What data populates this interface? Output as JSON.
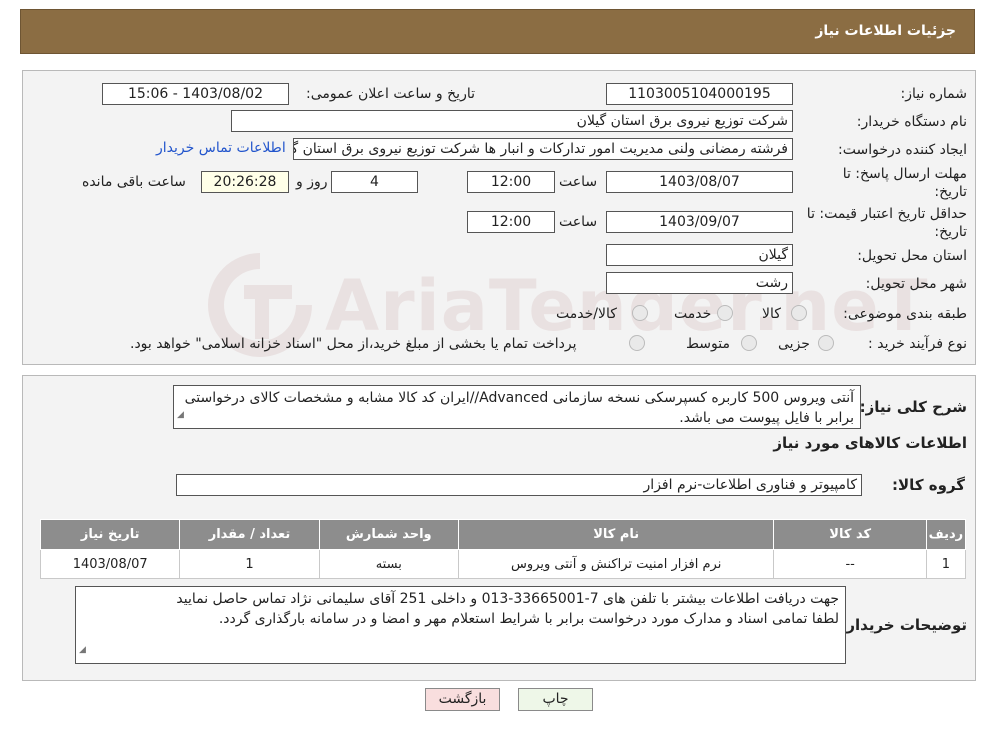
{
  "header": {
    "title": "جزئیات اطلاعات نیاز"
  },
  "info": {
    "need_number_label": "شماره نیاز:",
    "need_number": "1103005104000195",
    "announce_label": "تاریخ و ساعت اعلان عمومی:",
    "announce_value": "1403/08/02 - 15:06",
    "buyer_org_label": "نام دستگاه خریدار:",
    "buyer_org": "شرکت توزیع نیروی برق استان گیلان",
    "creator_label": "ایجاد کننده درخواست:",
    "creator": "فرشته رمضانی ولنی مدیریت امور تدارکات و انبار ها شرکت توزیع نیروی برق استان گیلان",
    "contact_link": "اطلاعات تماس خریدار",
    "reply_deadline_label_1": "مهلت ارسال پاسخ: تا",
    "reply_deadline_label_2": "تاریخ:",
    "reply_date": "1403/08/07",
    "time_label": "ساعت",
    "reply_time": "12:00",
    "days_value": "4",
    "days_label": "روز و",
    "remaining_time": "20:26:28",
    "remaining_label": "ساعت باقی مانده",
    "price_validity_label_1": "حداقل تاریخ اعتبار قیمت: تا",
    "price_validity_label_2": "تاریخ:",
    "price_date": "1403/09/07",
    "price_time": "12:00",
    "province_label": "استان محل تحویل:",
    "province": "گیلان",
    "city_label": "شهر محل تحویل:",
    "city": "رشت",
    "category_label": "طبقه بندی موضوعی:",
    "category_options": [
      "کالا",
      "خدمت",
      "کالا/خدمت"
    ],
    "process_label": "نوع فرآیند خرید :",
    "process_options": [
      "جزیی",
      "متوسط"
    ],
    "process_note": "پرداخت تمام یا بخشی از مبلغ خرید،از محل \"اسناد خزانه اسلامی\" خواهد بود."
  },
  "details": {
    "summary_label": "شرح کلی نیاز:",
    "summary": "آنتی ویروس 500 کاربره کسپرسکی نسخه سازمانی Advanced//ایران کد کالا مشابه و مشخصات کالای درخواستی برابر با فایل پیوست می باشد.",
    "goods_info_title": "اطلاعات کالاهای مورد نیاز",
    "goods_group_label": "گروه کالا:",
    "goods_group": "کامپیوتر و فناوری اطلاعات-نرم افزار",
    "table": {
      "headers": [
        "ردیف",
        "کد کالا",
        "نام کالا",
        "واحد شمارش",
        "تعداد / مقدار",
        "تاریخ نیاز"
      ],
      "rows": [
        [
          "1",
          "--",
          "نرم افزار امنیت تراکنش و آنتی ویروس",
          "بسته",
          "1",
          "1403/08/07"
        ]
      ]
    },
    "buyer_notes_label": "توضیحات خریدار:",
    "buyer_notes_line1": "جهت دریافت اطلاعات بیشتر با تلفن های 7-33665001-013 و داخلی 251 آقای سلیمانی نژاد تماس حاصل نمایید",
    "buyer_notes_line2": "لطفا تمامی اسناد و مدارک مورد درخواست برابر با شرایط استعلام مهر و امضا و در سامانه بارگذاری گردد."
  },
  "buttons": {
    "back": "بازگشت",
    "print": "چاپ"
  },
  "watermark": {
    "text": "AriaTender.neT"
  },
  "colors": {
    "header": "#8b6d43",
    "table_header": "#8d8d8d",
    "link": "#2255cc"
  }
}
